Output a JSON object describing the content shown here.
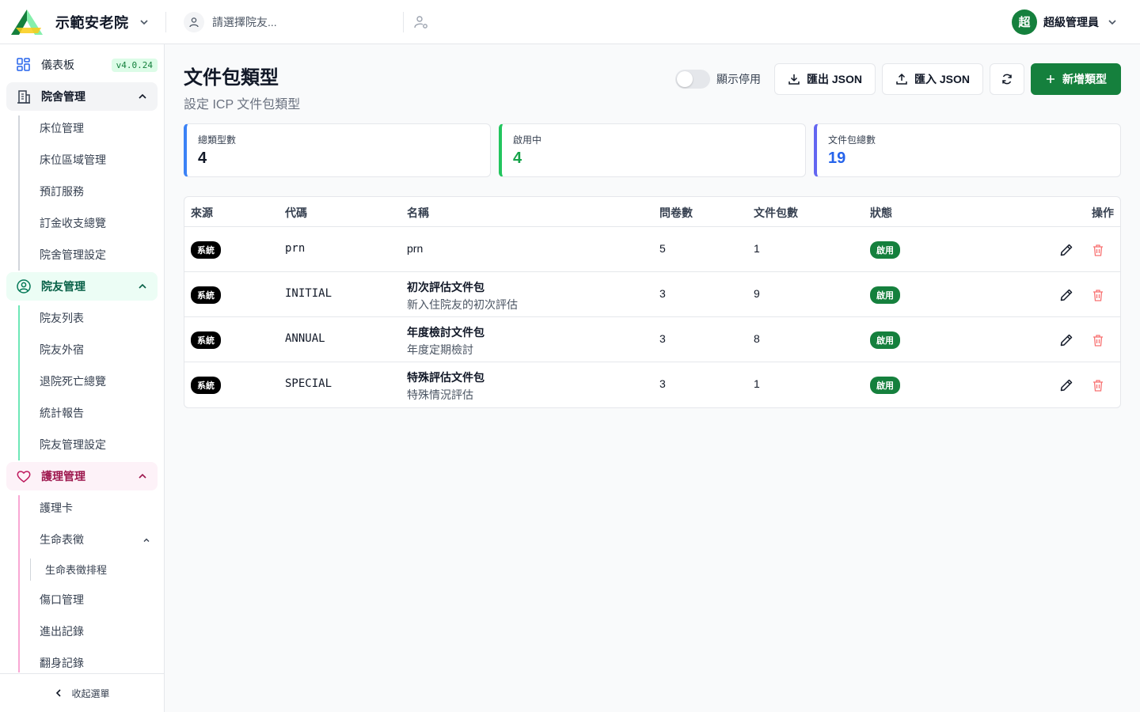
{
  "header": {
    "facility_name": "示範安老院",
    "resident_placeholder": "請選擇院友...",
    "user_initial": "超",
    "user_name": "超級管理員"
  },
  "sidebar": {
    "dashboard_label": "儀表板",
    "version": "v4.0.24",
    "groups": [
      {
        "label": "院舍管理",
        "items": [
          "床位管理",
          "床位區域管理",
          "預訂服務",
          "訂金收支總覽",
          "院舍管理設定"
        ]
      },
      {
        "label": "院友管理",
        "items": [
          "院友列表",
          "院友外宿",
          "退院死亡總覽",
          "統計報告",
          "院友管理設定"
        ]
      },
      {
        "label": "護理管理",
        "items": [
          "護理卡",
          "生命表徵",
          "生命表徵排程",
          "傷口管理",
          "進出記錄",
          "翻身記錄"
        ]
      }
    ],
    "collapse_label": "收起選單"
  },
  "page": {
    "title": "文件包類型",
    "subtitle": "設定 ICP 文件包類型",
    "show_disabled_label": "顯示停用",
    "export_label": "匯出 JSON",
    "import_label": "匯入 JSON",
    "add_label": "新增類型"
  },
  "stats": [
    {
      "label": "總類型數",
      "value": "4"
    },
    {
      "label": "啟用中",
      "value": "4"
    },
    {
      "label": "文件包總數",
      "value": "19"
    }
  ],
  "table": {
    "headers": [
      "來源",
      "代碼",
      "名稱",
      "問卷數",
      "文件包數",
      "狀態",
      "操作"
    ],
    "rows": [
      {
        "source": "系統",
        "code": "prn",
        "name": "prn",
        "desc": "",
        "questionnaires": "5",
        "packages": "1",
        "status": "啟用"
      },
      {
        "source": "系統",
        "code": "INITIAL",
        "name": "初次評估文件包",
        "desc": "新入住院友的初次評估",
        "questionnaires": "3",
        "packages": "9",
        "status": "啟用"
      },
      {
        "source": "系統",
        "code": "ANNUAL",
        "name": "年度檢討文件包",
        "desc": "年度定期檢討",
        "questionnaires": "3",
        "packages": "8",
        "status": "啟用"
      },
      {
        "source": "系統",
        "code": "SPECIAL",
        "name": "特殊評估文件包",
        "desc": "特殊情況評估",
        "questionnaires": "3",
        "packages": "1",
        "status": "啟用"
      }
    ]
  },
  "colors": {
    "primary": "#15803d",
    "danger": "#f87171",
    "stat_blue": "#3b82f6",
    "stat_green": "#22c55e",
    "stat_indigo": "#6366f1"
  }
}
